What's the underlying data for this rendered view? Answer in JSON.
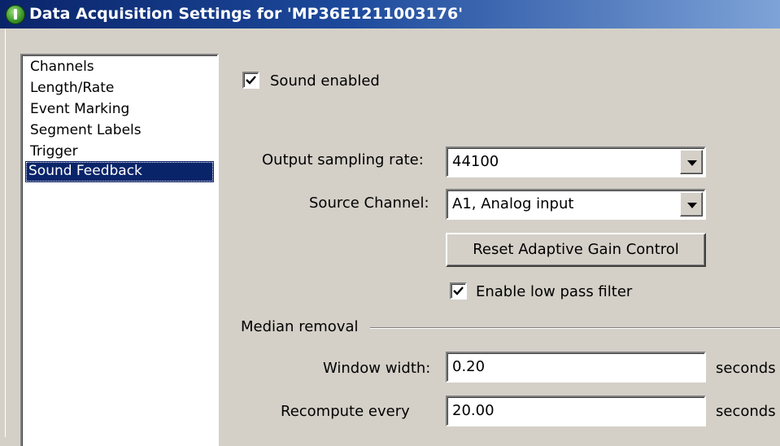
{
  "window": {
    "title": "Data Acquisition Settings for 'MP36E1211003176'"
  },
  "nav": {
    "items": [
      {
        "label": "Channels"
      },
      {
        "label": "Length/Rate"
      },
      {
        "label": "Event Marking"
      },
      {
        "label": "Segment Labels"
      },
      {
        "label": "Trigger"
      },
      {
        "label": "Sound Feedback",
        "selected": true
      }
    ]
  },
  "sound": {
    "enabled_label": "Sound enabled",
    "enabled_checked": true,
    "output_rate_label": "Output sampling rate:",
    "output_rate_value": "44100",
    "source_channel_label": "Source Channel:",
    "source_channel_value": "A1, Analog input",
    "reset_agc_label": "Reset Adaptive Gain Control",
    "low_pass_label": "Enable low pass filter",
    "low_pass_checked": true
  },
  "median": {
    "group_label": "Median removal",
    "window_width_label": "Window width:",
    "window_width_value": "0.20",
    "window_width_unit": "seconds",
    "recompute_label": "Recompute every",
    "recompute_value": "20.00",
    "recompute_unit": "seconds"
  },
  "colors": {
    "titlebar_start": "#0a246a",
    "titlebar_end": "#7ea3d8",
    "selection": "#0a246a",
    "dialog_bg": "#d4d0c8"
  },
  "icons": {
    "app": "app-icon",
    "check": "checkmark-icon",
    "dropdown": "chevron-down-icon"
  }
}
